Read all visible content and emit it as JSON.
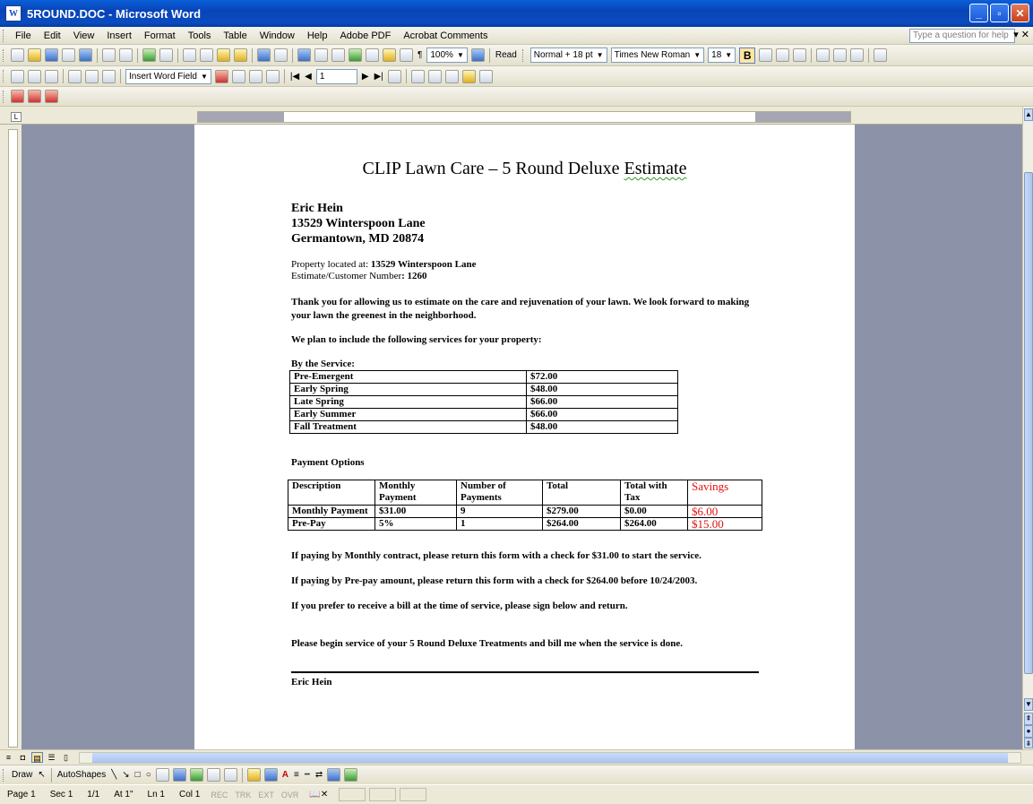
{
  "window": {
    "title": "5ROUND.DOC - Microsoft Word",
    "app_icon": "W"
  },
  "menu": {
    "items": [
      "File",
      "Edit",
      "View",
      "Insert",
      "Format",
      "Tools",
      "Table",
      "Window",
      "Help",
      "Adobe PDF",
      "Acrobat Comments"
    ],
    "help_placeholder": "Type a question for help"
  },
  "toolbar": {
    "zoom": "100%",
    "read_label": "Read",
    "style": "Normal + 18 pt",
    "font": "Times New Roman",
    "size": "18",
    "bold": "B",
    "insert_word_field": "Insert Word Field",
    "record_number": "1"
  },
  "drawing": {
    "draw_label": "Draw",
    "autoshapes_label": "AutoShapes"
  },
  "status": {
    "page": "Page 1",
    "sec": "Sec 1",
    "pages": "1/1",
    "at": "At 1\"",
    "ln": "Ln 1",
    "col": "Col 1",
    "rec": "REC",
    "trk": "TRK",
    "ext": "EXT",
    "ovr": "OVR"
  },
  "document": {
    "title_main": "CLIP Lawn Care – 5 Round Deluxe ",
    "title_tail": "Estimate",
    "name": "Eric Hein",
    "address1": "13529 Winterspoon Lane",
    "address2": "Germantown, MD  20874",
    "property_label": "Property located at: ",
    "property_value": "13529 Winterspoon Lane",
    "customer_label": "Estimate/Customer Number",
    "customer_value": ": 1260",
    "thanks": "Thank you for allowing us to estimate on the care and rejuvenation of your lawn.  We look forward to making your lawn the greenest in the neighborhood.",
    "plan": "We plan to include the following services for your property:",
    "by_service": "By the Service:",
    "services": [
      {
        "name": "Pre-Emergent",
        "price": "$72.00"
      },
      {
        "name": "Early Spring",
        "price": "$48.00"
      },
      {
        "name": "Late Spring",
        "price": "$66.00"
      },
      {
        "name": "Early Summer",
        "price": "$66.00"
      },
      {
        "name": "Fall Treatment",
        "price": "$48.00"
      }
    ],
    "payment_options": "Payment Options",
    "payment_headers": [
      "Description",
      "Monthly Payment",
      "Number of Payments",
      "Total",
      "Total with Tax",
      "Savings"
    ],
    "payment_rows": [
      [
        "Monthly Payment",
        "$31.00",
        "9",
        "$279.00",
        "$0.00",
        "$6.00"
      ],
      [
        "Pre-Pay",
        "5%",
        "1",
        "$264.00",
        "$264.00",
        "$15.00"
      ]
    ],
    "note_monthly": "If paying by Monthly contract, please return this form with a check for $31.00 to start the service.",
    "note_prepay": "If paying by Pre-pay amount, please return this form with a check for $264.00 before 10/24/2003.",
    "note_bill": "If you prefer to receive a bill at the time of service, please sign below and return.",
    "note_begin": "Please begin service of your 5 Round Deluxe Treatments and bill me when the service is done.",
    "signature_name": "Eric Hein"
  }
}
